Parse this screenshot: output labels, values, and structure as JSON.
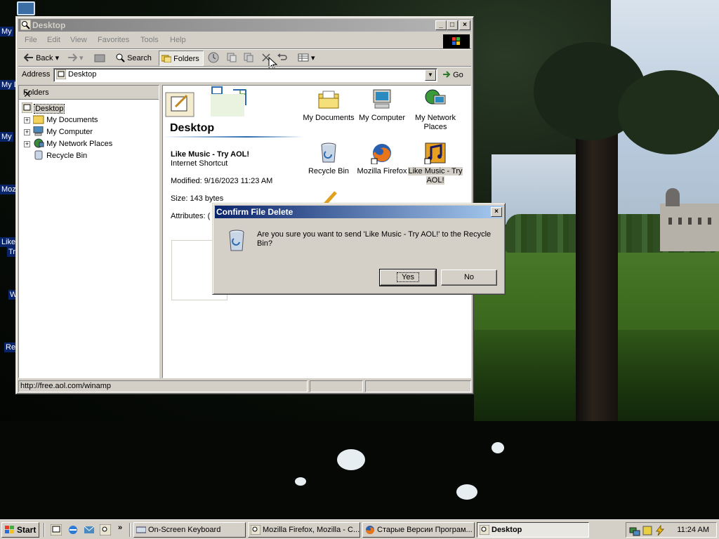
{
  "desktop": {
    "left_labels": [
      "My",
      "My Do",
      "My",
      "Moz",
      "Like",
      "Tr",
      "W",
      "Re"
    ]
  },
  "explorer": {
    "title": "Desktop",
    "menu": [
      "File",
      "Edit",
      "View",
      "Favorites",
      "Tools",
      "Help"
    ],
    "toolbar": {
      "back": "Back",
      "search": "Search",
      "folders": "Folders"
    },
    "address_label": "Address",
    "address_value": "Desktop",
    "go_label": "Go",
    "folders_pane": {
      "title": "Folders",
      "items": [
        "Desktop",
        "My Documents",
        "My Computer",
        "My Network Places",
        "Recycle Bin"
      ]
    },
    "webview": {
      "title": "Desktop",
      "selected_name": "Like Music - Try AOL!",
      "selected_type": "Internet Shortcut",
      "modified": "Modified: 9/16/2023 11:23 AM",
      "size": "Size: 143 bytes",
      "attributes": "Attributes: ("
    },
    "icons": [
      {
        "label": "My Documents",
        "icon": "my-documents-icon"
      },
      {
        "label": "My Computer",
        "icon": "my-computer-icon"
      },
      {
        "label": "My Network Places",
        "icon": "network-places-icon"
      },
      {
        "label": "Recycle Bin",
        "icon": "recycle-bin-icon"
      },
      {
        "label": "Mozilla Firefox",
        "icon": "firefox-icon"
      },
      {
        "label": "Like Music - Try AOL!",
        "icon": "winamp-icon"
      }
    ],
    "status": "http://free.aol.com/winamp"
  },
  "dialog": {
    "title": "Confirm File Delete",
    "message": "Are you sure you want to send 'Like Music - Try AOL!' to the Recycle Bin?",
    "yes": "Yes",
    "no": "No"
  },
  "taskbar": {
    "start": "Start",
    "tasks": [
      "On-Screen Keyboard",
      "Mozilla Firefox, Mozilla - C...",
      "Старые Версии Програм...",
      "Desktop"
    ],
    "clock": "11:24 AM"
  },
  "colors": {
    "titlebar_active": "#0a246a",
    "titlebar_inactive": "#808080",
    "face": "#d4d0c8"
  }
}
